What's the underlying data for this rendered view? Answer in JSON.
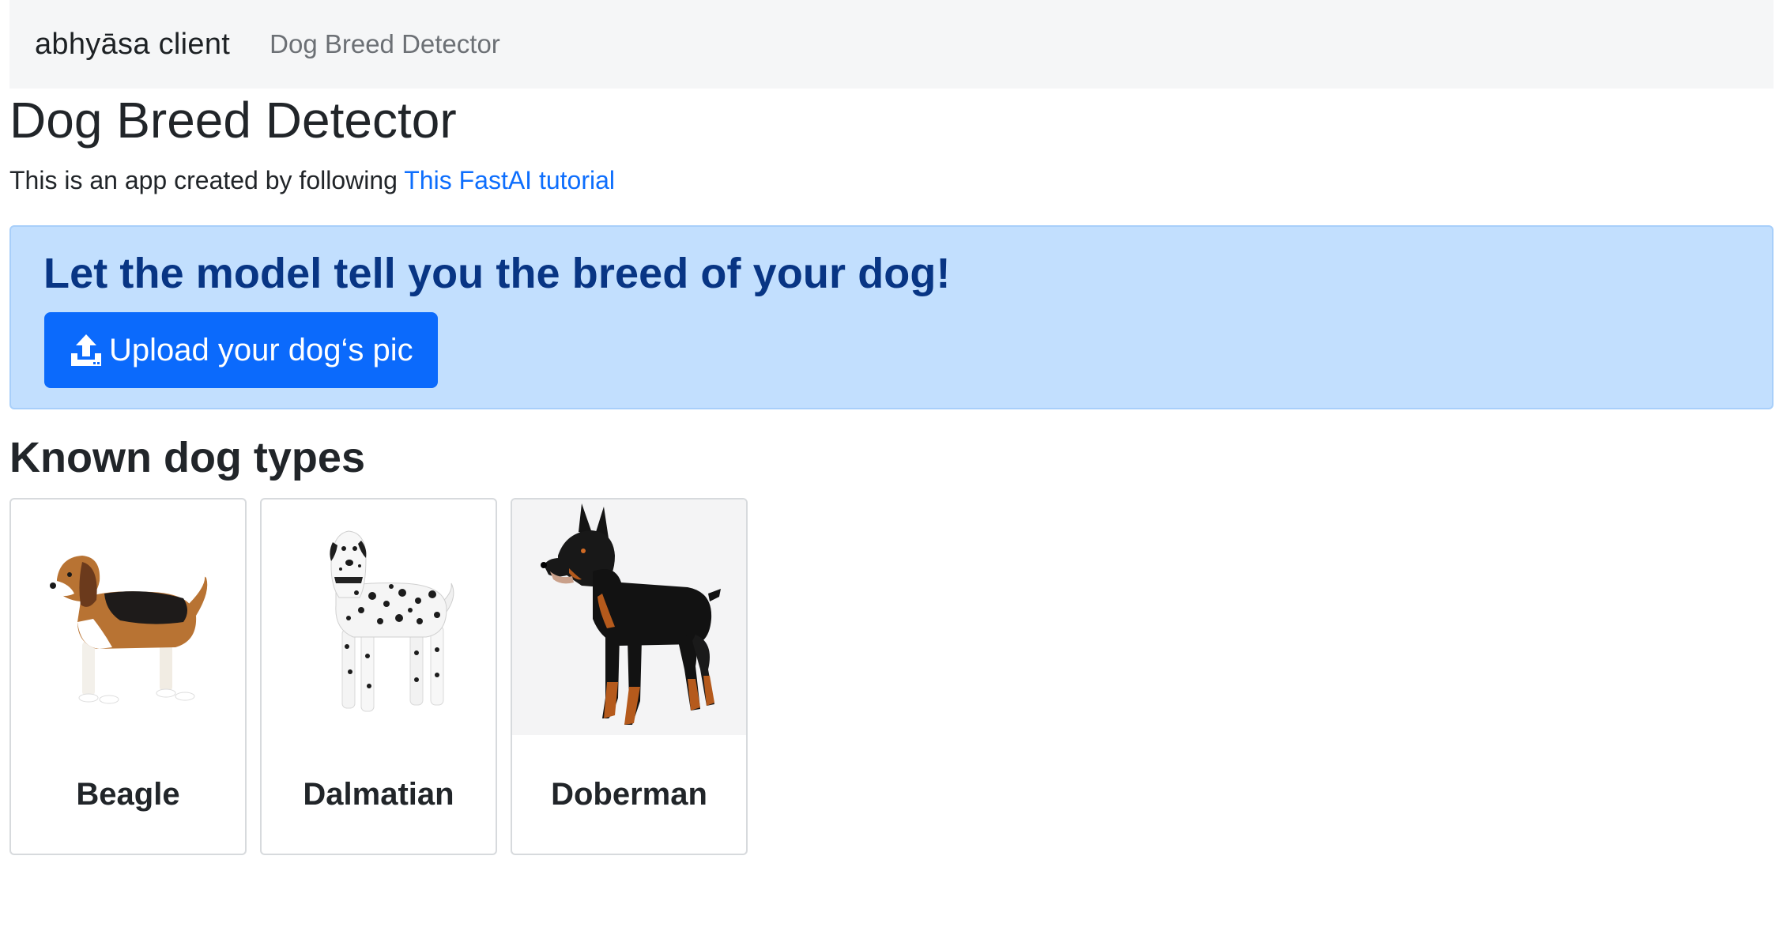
{
  "navbar": {
    "brand": "abhyāsa client",
    "link": "Dog Breed Detector"
  },
  "main": {
    "title": "Dog Breed Detector",
    "intro_text": "This is an app created by following ",
    "intro_link": "This FastAI tutorial"
  },
  "callout": {
    "title": "Let the model tell you the breed of your dog!",
    "upload_label": "Upload your dog‘s pic",
    "upload_icon": "upload-icon"
  },
  "known": {
    "title": "Known dog types",
    "cards": [
      {
        "name": "Beagle",
        "image": "beagle-photo"
      },
      {
        "name": "Dalmatian",
        "image": "dalmatian-photo"
      },
      {
        "name": "Doberman",
        "image": "doberman-photo"
      }
    ]
  },
  "colors": {
    "navbar_bg": "#f5f6f7",
    "link": "#0d6efd",
    "callout_bg": "#c2dffe",
    "callout_text": "#083584",
    "button_bg": "#0b6afc"
  }
}
